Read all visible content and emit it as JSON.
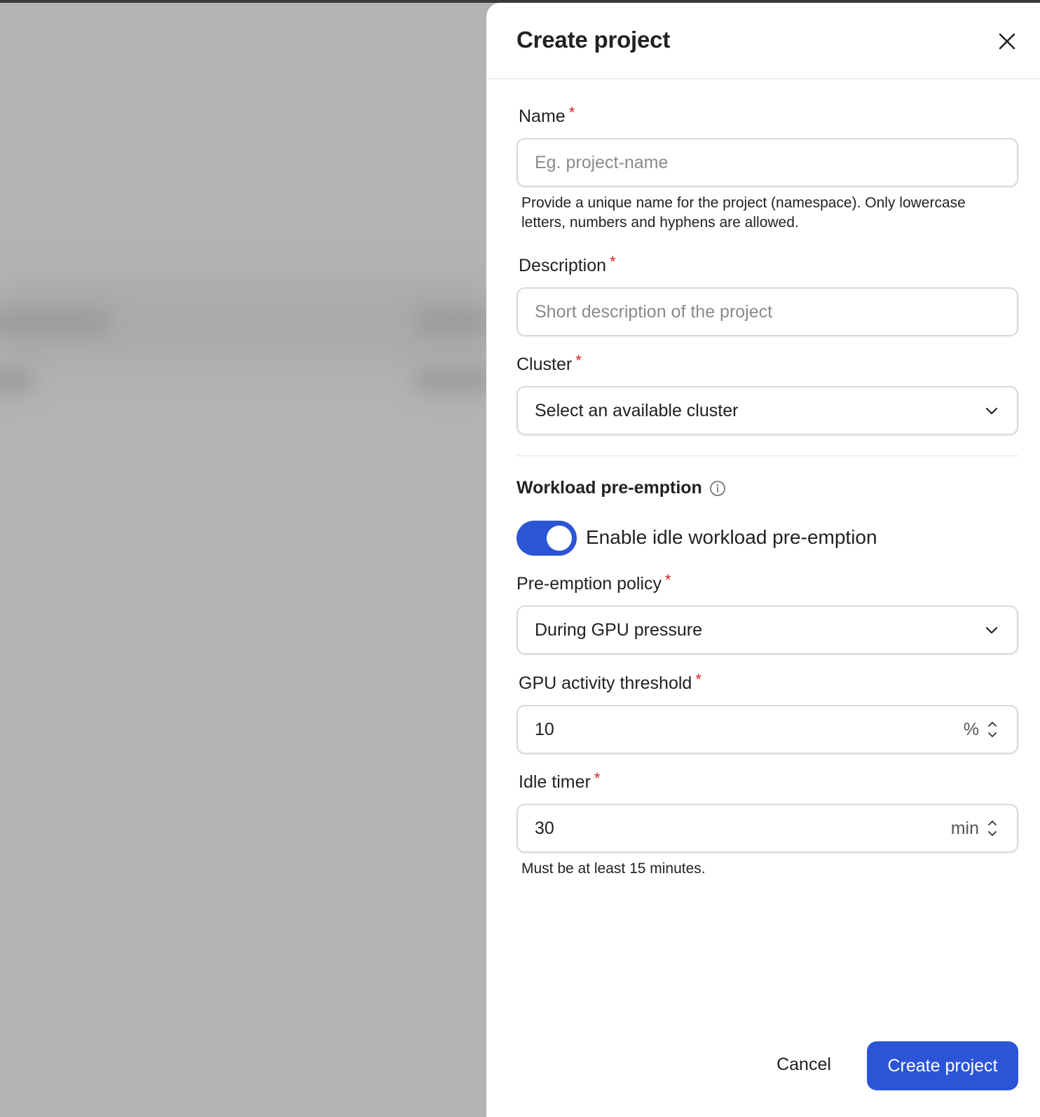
{
  "drawer": {
    "title": "Create project",
    "close_icon": "close-icon"
  },
  "form": {
    "name": {
      "label": "Name",
      "required_mark": "*",
      "placeholder": "Eg. project-name",
      "value": "",
      "help": "Provide a unique name for the project (namespace). Only lowercase letters, numbers and hyphens are allowed."
    },
    "description": {
      "label": "Description",
      "required_mark": "*",
      "placeholder": "Short description of the project",
      "value": ""
    },
    "cluster": {
      "label": "Cluster",
      "required_mark": "*",
      "selected": "Select an available cluster",
      "icon": "chevron-down-icon"
    },
    "preemption": {
      "section_title": "Workload pre-emption",
      "info_icon": "info-icon",
      "toggle_label": "Enable idle workload pre-emption",
      "toggle_on": true,
      "policy": {
        "label": "Pre-emption policy",
        "required_mark": "*",
        "selected": "During GPU pressure"
      },
      "gpu_threshold": {
        "label": "GPU activity threshold",
        "required_mark": "*",
        "value": "10",
        "unit": "%"
      },
      "idle_timer": {
        "label": "Idle timer",
        "required_mark": "*",
        "value": "30",
        "unit": "min",
        "help": "Must be at least 15 minutes."
      }
    }
  },
  "footer": {
    "cancel_label": "Cancel",
    "submit_label": "Create project"
  },
  "colors": {
    "primary": "#2b55d6",
    "required": "#d62020",
    "overlay": "#b3b3b3"
  }
}
